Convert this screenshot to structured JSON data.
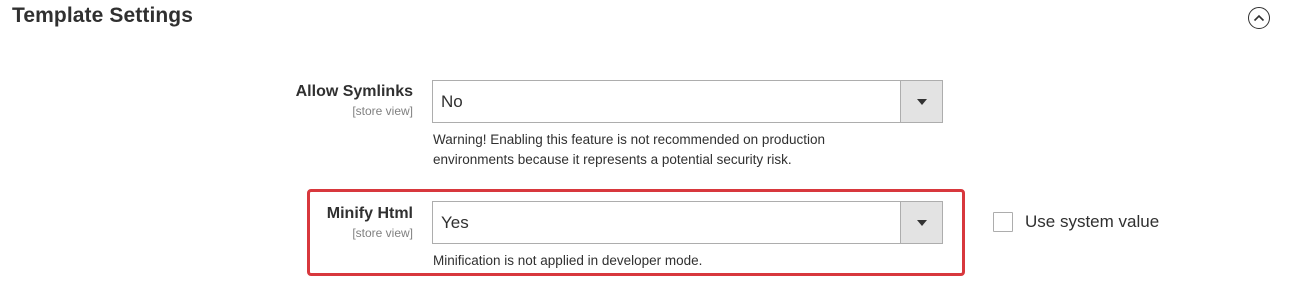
{
  "section": {
    "title": "Template Settings",
    "collapse_icon": "chevron-up-circle-icon"
  },
  "fields": {
    "allow_symlinks": {
      "label": "Allow Symlinks",
      "scope": "[store view]",
      "value": "No",
      "note_line1": "Warning! Enabling this feature is not recommended on production",
      "note_line2": "environments because it represents a potential security risk."
    },
    "minify_html": {
      "label": "Minify Html",
      "scope": "[store view]",
      "value": "Yes",
      "note": "Minification is not applied in developer mode.",
      "use_system_value_label": "Use system value",
      "use_system_value_checked": false,
      "highlight_color": "#d8383d"
    }
  }
}
